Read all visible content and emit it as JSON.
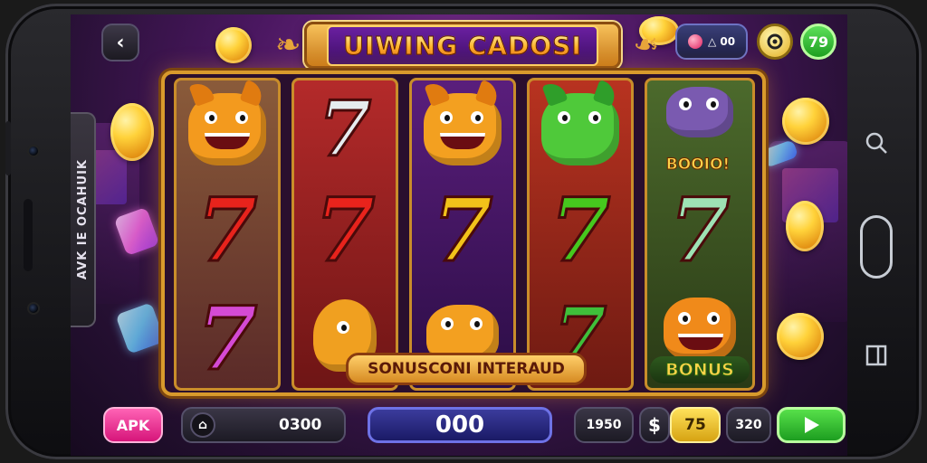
{
  "header": {
    "back_icon": "chevron-left-icon",
    "title": "UIWING CADOSI",
    "stat_value": "00",
    "stat_prefix": "△ 00",
    "settings_icon": "gear-icon",
    "green_badge": "79"
  },
  "side_panel": {
    "text": "AVK IE OCAHUIK"
  },
  "reels": [
    {
      "top": "monster-orange",
      "middle": "7",
      "bottom": "7"
    },
    {
      "top": "7",
      "middle": "7",
      "bottom": "monster-orange-tail"
    },
    {
      "top": "monster-orange",
      "middle": "7",
      "bottom": "monster-orange"
    },
    {
      "top": "monster-green",
      "middle": "7",
      "bottom": "7"
    },
    {
      "top": "monster-purple",
      "middle": "7",
      "bottom": "monster-orange"
    }
  ],
  "banners": {
    "booo": "BOOIO!",
    "bonus_interaud": "SONUSCONI INTERAUD",
    "bonus": "BONUS"
  },
  "bottom_bar": {
    "apk_label": "APK",
    "home_icon": "home-icon",
    "balance": "0300",
    "total": "000",
    "bet_a": "1950",
    "dollar": "$",
    "bet_yellow": "75",
    "bet_b": "320",
    "spin_icon": "play-icon"
  },
  "nav": {
    "search_icon": "search-icon",
    "home_icon": "home-button-icon",
    "recents_icon": "recents-icon"
  },
  "colors": {
    "reel_gold": "#d89a2c",
    "seven_red": "#e8231c",
    "seven_green": "#46c81e",
    "seven_pink": "#d54ad4",
    "spin_green": "#2fb72f",
    "apk_pink": "#e0288b"
  }
}
